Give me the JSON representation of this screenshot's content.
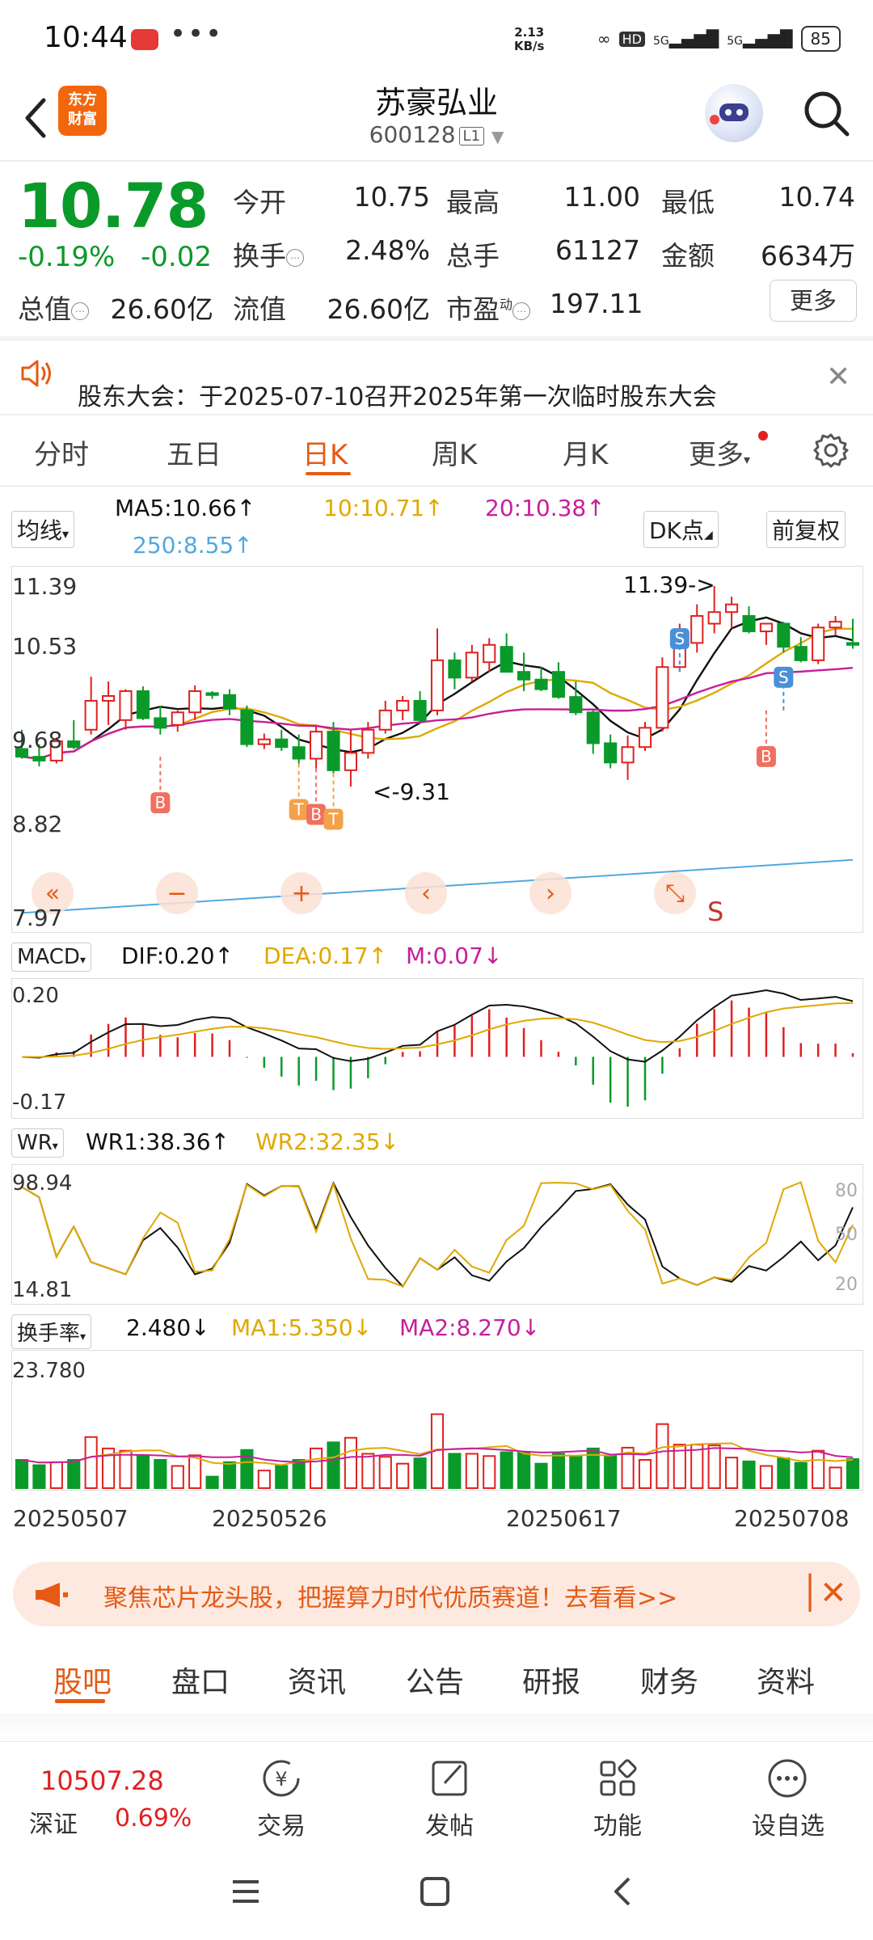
{
  "status_bar": {
    "time": "10:44",
    "dots": "•••",
    "speed_value": "2.13",
    "speed_unit": "KB/s",
    "hd": "HD",
    "net1": "5G",
    "net2": "5G",
    "battery": "85"
  },
  "header": {
    "logo_line1": "东方",
    "logo_line2": "财富",
    "title": "苏豪弘业",
    "code": "600128",
    "level": "L1"
  },
  "quote": {
    "price": "10.78",
    "change_pct": "-0.19%",
    "change": "-0.02",
    "open_label": "今开",
    "open": "10.75",
    "high_label": "最高",
    "high": "11.00",
    "low_label": "最低",
    "low": "10.74",
    "turnover_label": "换手",
    "turnover": "2.48%",
    "volume_label": "总手",
    "volume": "61127",
    "amount_label": "金额",
    "amount": "6634万",
    "mktcap_label": "总值",
    "mktcap": "26.60亿",
    "float_label": "流值",
    "float": "26.60亿",
    "pe_label": "市盈",
    "pe_sup": "动",
    "pe": "197.11",
    "more": "更多"
  },
  "notice": {
    "text": "股东大会：于2025-07-10召开2025年第一次临时股东大会"
  },
  "chart_tabs": [
    "分时",
    "五日",
    "日K",
    "周K",
    "月K",
    "更多"
  ],
  "ma": {
    "selector": "均线",
    "ma5": "MA5:10.66",
    "ma10": "10:10.71",
    "ma20": "20:10.38",
    "ma250": "250:8.55",
    "dk": "DK点",
    "adj": "前复权"
  },
  "kline": {
    "y_top": "11.39",
    "y_mid1": "10.53",
    "y_mid2": "9.68",
    "y_mid3": "8.82",
    "y_bottom": "7.97",
    "high_annot": "11.39->",
    "low_annot": "<-9.31",
    "ctrl_s": "S",
    "markers": {
      "b": "B",
      "t": "T",
      "s": "S"
    }
  },
  "macd": {
    "selector": "MACD",
    "dif": "DIF:0.20",
    "dea": "DEA:0.17",
    "m": "M:0.07",
    "y_top": "0.20",
    "y_bottom": "-0.17"
  },
  "wr": {
    "selector": "WR",
    "wr1": "WR1:38.36",
    "wr2": "WR2:32.35",
    "y_top": "98.94",
    "y_bottom": "14.81",
    "r80": "80",
    "r50": "50",
    "r20": "20"
  },
  "turnover_ind": {
    "selector": "换手率",
    "value": "2.480",
    "ma1": "MA1:5.350",
    "ma2": "MA2:8.270",
    "y_top": "23.780"
  },
  "dates": [
    "20250507",
    "20250526",
    "20250617",
    "20250708"
  ],
  "banner": {
    "text": "聚焦芯片龙头股，把握算力时代优质赛道！去看看>>"
  },
  "bottom_tabs": [
    "股吧",
    "盘口",
    "资讯",
    "公告",
    "研报",
    "财务",
    "资料"
  ],
  "bottom_nav": {
    "index_value": "10507.28",
    "index_name": "深证",
    "index_change": "0.69%",
    "trade": "交易",
    "post": "发帖",
    "features": "功能",
    "watchlist": "设自选"
  },
  "colors": {
    "up": "#e02020",
    "down": "#0a9a2a",
    "accent": "#e55a14",
    "ma10": "#e0a800",
    "ma20": "#c81e9b",
    "ma250": "#52a8e0"
  },
  "chart_data": {
    "type": "candlestick",
    "x_start": "20250507",
    "x_end": "20250711",
    "ylim": [
      7.97,
      11.39
    ],
    "candles": [
      [
        9.7,
        9.9,
        9.6,
        9.62
      ],
      [
        9.62,
        9.75,
        9.52,
        9.58
      ],
      [
        9.58,
        9.82,
        9.55,
        9.78
      ],
      [
        9.78,
        10.0,
        9.7,
        9.72
      ],
      [
        9.9,
        10.45,
        9.85,
        10.2
      ],
      [
        10.2,
        10.4,
        9.95,
        10.25
      ],
      [
        10.0,
        10.32,
        9.9,
        10.3
      ],
      [
        10.3,
        10.35,
        10.0,
        10.02
      ],
      [
        10.02,
        10.15,
        9.85,
        9.92
      ],
      [
        9.95,
        10.1,
        9.88,
        10.08
      ],
      [
        10.08,
        10.36,
        10.0,
        10.3
      ],
      [
        10.28,
        10.3,
        10.22,
        10.26
      ],
      [
        10.26,
        10.32,
        10.05,
        10.12
      ],
      [
        10.1,
        10.15,
        9.72,
        9.75
      ],
      [
        9.75,
        9.86,
        9.7,
        9.8
      ],
      [
        9.8,
        9.9,
        9.68,
        9.72
      ],
      [
        9.72,
        9.85,
        9.55,
        9.6
      ],
      [
        9.6,
        9.95,
        9.5,
        9.88
      ],
      [
        9.88,
        9.98,
        9.45,
        9.48
      ],
      [
        9.48,
        9.9,
        9.31,
        9.66
      ],
      [
        9.66,
        9.98,
        9.6,
        9.9
      ],
      [
        9.9,
        10.2,
        9.86,
        10.1
      ],
      [
        10.1,
        10.25,
        10.0,
        10.2
      ],
      [
        10.2,
        10.3,
        9.98,
        10.0
      ],
      [
        10.1,
        10.95,
        10.05,
        10.62
      ],
      [
        10.62,
        10.7,
        10.32,
        10.44
      ],
      [
        10.44,
        10.78,
        10.4,
        10.7
      ],
      [
        10.6,
        10.85,
        10.5,
        10.78
      ],
      [
        10.76,
        10.9,
        10.5,
        10.5
      ],
      [
        10.5,
        10.7,
        10.3,
        10.42
      ],
      [
        10.42,
        10.55,
        10.3,
        10.32
      ],
      [
        10.5,
        10.6,
        10.22,
        10.24
      ],
      [
        10.24,
        10.4,
        10.05,
        10.08
      ],
      [
        10.08,
        10.1,
        9.65,
        9.76
      ],
      [
        9.76,
        9.85,
        9.5,
        9.56
      ],
      [
        9.56,
        9.84,
        9.38,
        9.72
      ],
      [
        9.72,
        9.98,
        9.68,
        9.92
      ],
      [
        9.92,
        10.65,
        9.88,
        10.55
      ],
      [
        10.55,
        11.0,
        10.5,
        10.8
      ],
      [
        10.8,
        11.2,
        10.7,
        11.08
      ],
      [
        11.0,
        11.39,
        10.9,
        11.12
      ],
      [
        11.12,
        11.28,
        10.95,
        11.2
      ],
      [
        11.08,
        11.18,
        10.9,
        10.92
      ],
      [
        10.92,
        11.0,
        10.78,
        11.0
      ],
      [
        11.0,
        11.02,
        10.7,
        10.76
      ],
      [
        10.76,
        10.86,
        10.6,
        10.62
      ],
      [
        10.62,
        11.0,
        10.58,
        10.96
      ],
      [
        10.96,
        11.08,
        10.88,
        11.02
      ],
      [
        10.8,
        11.05,
        10.74,
        10.78
      ]
    ]
  }
}
